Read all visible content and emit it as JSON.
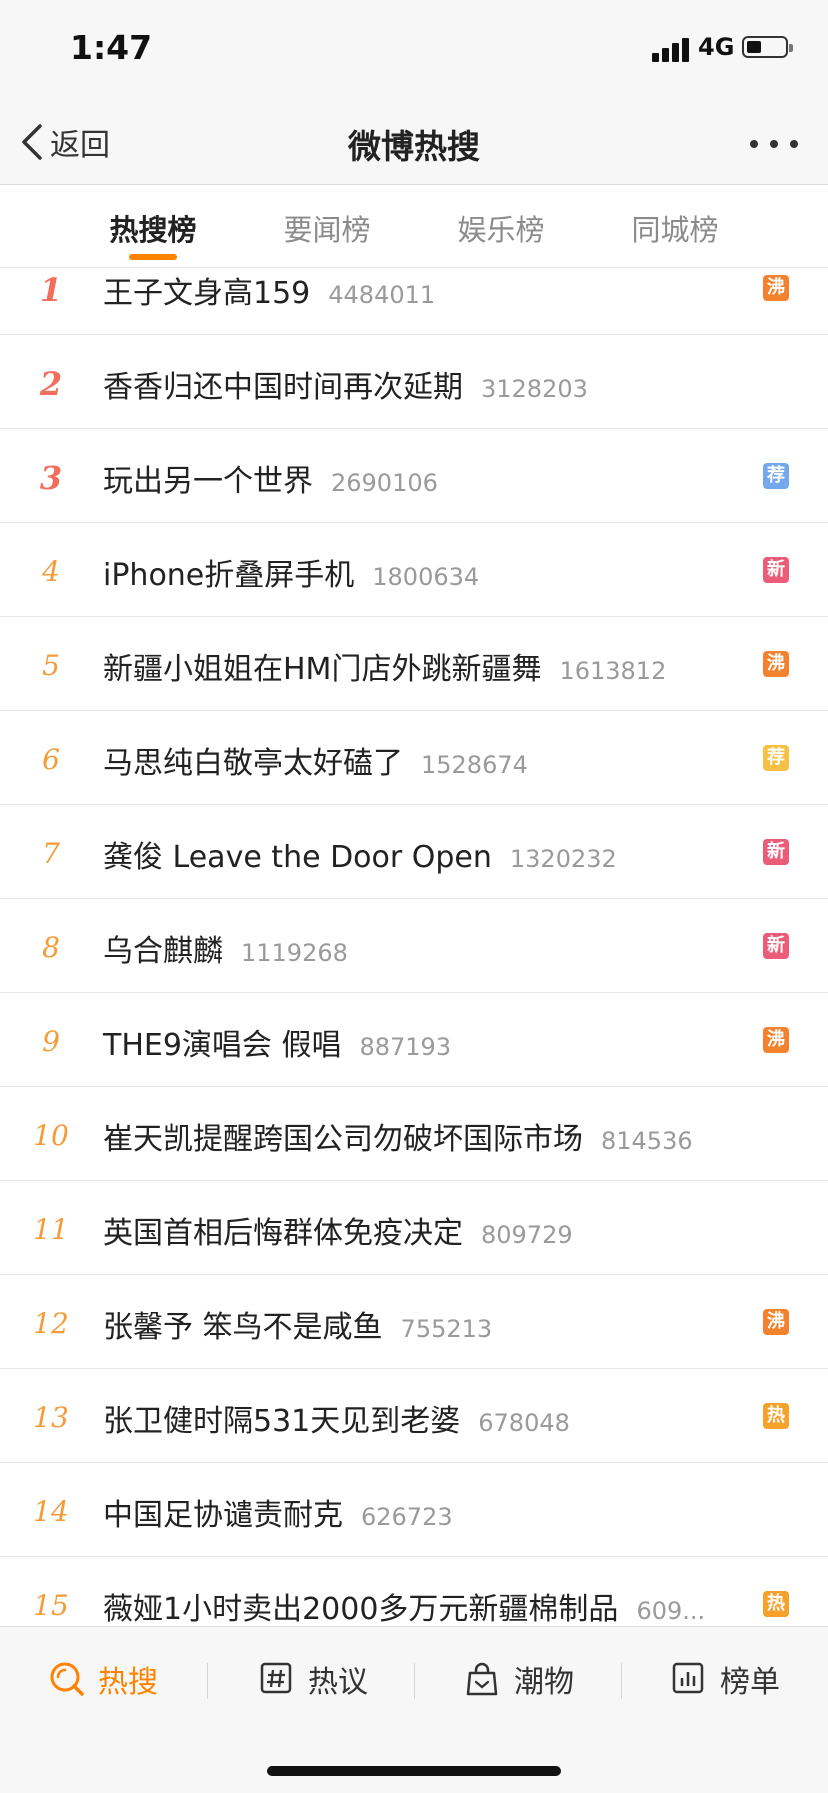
{
  "status_bar": {
    "time": "1:47",
    "network": "4G",
    "battery_icon": "battery-icon",
    "signal_icon": "signal-icon"
  },
  "nav": {
    "back_label": "返回",
    "title": "微博热搜",
    "more_icon": "more-icon"
  },
  "tabs": [
    {
      "label": "热搜榜",
      "active": true
    },
    {
      "label": "要闻榜",
      "active": false
    },
    {
      "label": "娱乐榜",
      "active": false
    },
    {
      "label": "同城榜",
      "active": false
    }
  ],
  "colors": {
    "accent": "#ff8200",
    "rank_top": "#f26d5b",
    "rank_other": "#f39c38",
    "badge_boil": "#f4812b",
    "badge_recommend_blue": "#73a8ec",
    "badge_new": "#ec5b78",
    "badge_recommend_yellow": "#f6c044",
    "badge_hot": "#f6a12a"
  },
  "list": [
    {
      "rank": "1",
      "title": "王子文身高159",
      "count": "4484011",
      "badge": "沸",
      "badge_color": "#f4812b"
    },
    {
      "rank": "2",
      "title": "香香归还中国时间再次延期",
      "count": "3128203",
      "badge": "",
      "badge_color": ""
    },
    {
      "rank": "3",
      "title": "玩出另一个世界",
      "count": "2690106",
      "badge": "荐",
      "badge_color": "#73a8ec"
    },
    {
      "rank": "4",
      "title": "iPhone折叠屏手机",
      "count": "1800634",
      "badge": "新",
      "badge_color": "#ec5b78"
    },
    {
      "rank": "5",
      "title": "新疆小姐姐在HM门店外跳新疆舞",
      "count": "1613812",
      "badge": "沸",
      "badge_color": "#f4812b"
    },
    {
      "rank": "6",
      "title": "马思纯白敬亭太好磕了",
      "count": "1528674",
      "badge": "荐",
      "badge_color": "#f6c044"
    },
    {
      "rank": "7",
      "title": "龚俊 Leave the Door Open",
      "count": "1320232",
      "badge": "新",
      "badge_color": "#ec5b78"
    },
    {
      "rank": "8",
      "title": "乌合麒麟",
      "count": "1119268",
      "badge": "新",
      "badge_color": "#ec5b78"
    },
    {
      "rank": "9",
      "title": "THE9演唱会 假唱",
      "count": "887193",
      "badge": "沸",
      "badge_color": "#f4812b"
    },
    {
      "rank": "10",
      "title": "崔天凯提醒跨国公司勿破坏国际市场",
      "count": "814536",
      "badge": "",
      "badge_color": ""
    },
    {
      "rank": "11",
      "title": "英国首相后悔群体免疫决定",
      "count": "809729",
      "badge": "",
      "badge_color": ""
    },
    {
      "rank": "12",
      "title": "张馨予 笨鸟不是咸鱼",
      "count": "755213",
      "badge": "沸",
      "badge_color": "#f4812b"
    },
    {
      "rank": "13",
      "title": "张卫健时隔531天见到老婆",
      "count": "678048",
      "badge": "热",
      "badge_color": "#f6a12a"
    },
    {
      "rank": "14",
      "title": "中国足协谴责耐克",
      "count": "626723",
      "badge": "",
      "badge_color": ""
    },
    {
      "rank": "15",
      "title": "薇娅1小时卖出2000多万元新疆棉制品",
      "count": "609...",
      "badge": "热",
      "badge_color": "#f6a12a"
    }
  ],
  "bottom_nav": [
    {
      "label": "热搜",
      "icon": "hot-search-icon",
      "active": true
    },
    {
      "label": "热议",
      "icon": "hashtag-icon",
      "active": false
    },
    {
      "label": "潮物",
      "icon": "shopping-bag-icon",
      "active": false
    },
    {
      "label": "榜单",
      "icon": "chart-icon",
      "active": false
    }
  ]
}
